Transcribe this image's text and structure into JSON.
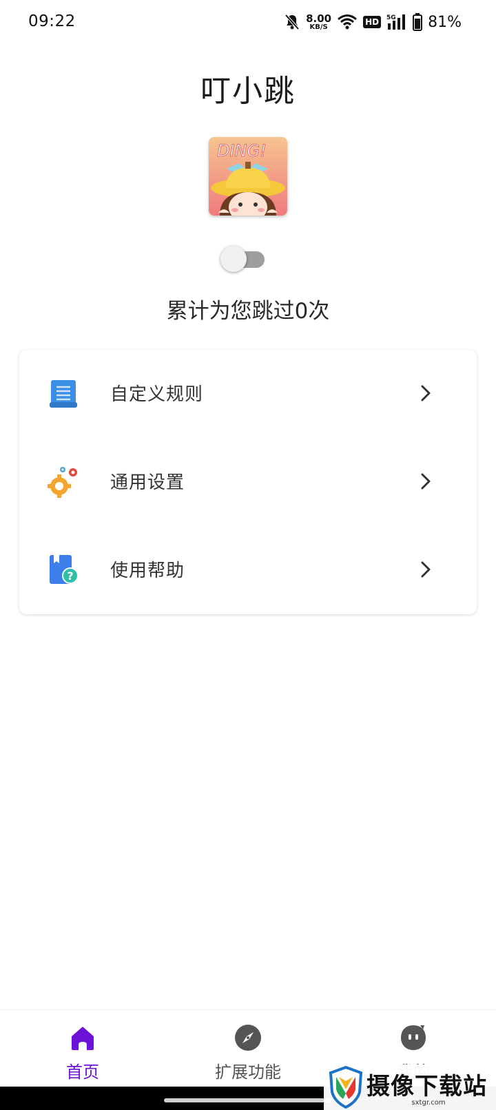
{
  "status_bar": {
    "time": "09:22",
    "net_speed_value": "8.00",
    "net_speed_unit": "KB/S",
    "hd_badge": "HD",
    "signal_type": "5G",
    "battery_percent": "81%",
    "icons": [
      "mute-bell-icon",
      "wifi-icon",
      "hd-icon",
      "signal-icon",
      "battery-icon"
    ]
  },
  "header": {
    "app_title": "叮小跳",
    "logo_text": "DING!",
    "service_toggle_on": false,
    "skip_count_text": "累计为您跳过0次"
  },
  "menu": {
    "items": [
      {
        "label": "自定义规则",
        "icon": "rules-document-icon"
      },
      {
        "label": "通用设置",
        "icon": "gears-icon"
      },
      {
        "label": "使用帮助",
        "icon": "help-book-icon"
      }
    ]
  },
  "bottom_nav": {
    "items": [
      {
        "label": "首页",
        "icon": "home-icon",
        "active": true
      },
      {
        "label": "扩展功能",
        "icon": "compass-icon",
        "active": false
      },
      {
        "label": "我的",
        "icon": "profile-face-icon",
        "active": false
      }
    ]
  },
  "watermark": {
    "title": "摄像下载站",
    "url": "sxtgr.com"
  },
  "colors": {
    "accent": "#6d12d9",
    "toggle_track": "#9e9e9e",
    "nav_inactive": "#555555"
  }
}
